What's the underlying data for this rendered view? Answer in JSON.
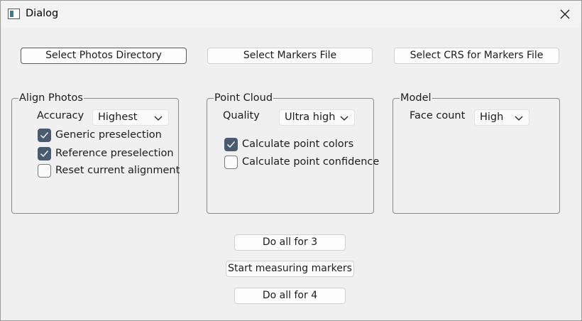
{
  "window": {
    "title": "Dialog",
    "icons": {
      "app": "window-app-icon",
      "close": "close-icon"
    }
  },
  "top_buttons": {
    "photos": "Select Photos Directory",
    "markers": "Select Markers File",
    "crs": "Select CRS for Markers File"
  },
  "align_photos": {
    "title": "Align Photos",
    "accuracy_label": "Accuracy",
    "accuracy_value": "Highest",
    "options": [
      {
        "label": "Generic preselection",
        "checked": true
      },
      {
        "label": "Reference preselection",
        "checked": true
      },
      {
        "label": "Reset current alignment",
        "checked": false
      }
    ]
  },
  "point_cloud": {
    "title": "Point Cloud",
    "quality_label": "Quality",
    "quality_value": "Ultra high",
    "options": [
      {
        "label": "Calculate point colors",
        "checked": true
      },
      {
        "label": "Calculate point confidence",
        "checked": false
      }
    ]
  },
  "model": {
    "title": "Model",
    "face_count_label": "Face count",
    "face_count_value": "High"
  },
  "bottom_buttons": {
    "do_all_3": "Do all for 3",
    "start_measuring": "Start measuring markers",
    "do_all_4": "Do all for 4"
  },
  "colors": {
    "checkbox_checked": "#4a5a70",
    "background": "#f0f0f0"
  }
}
